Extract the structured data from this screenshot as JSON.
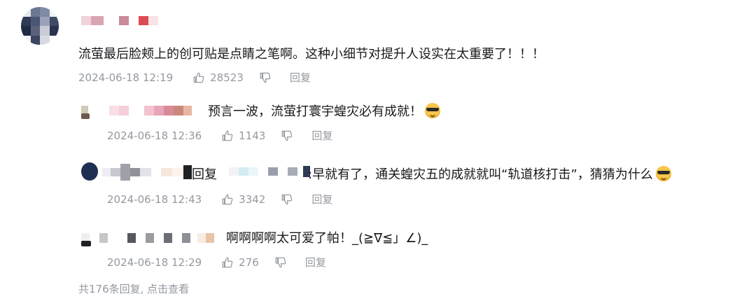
{
  "main_comment": {
    "text": "流萤最后脸颊上的创可贴是点睛之笔啊。这种小细节对提升人设实在太重要了！！！",
    "time": "2024-06-18 12:19",
    "likes": "28523",
    "reply_label": "回复"
  },
  "replies": [
    {
      "text": "预言一波，流萤打寰宇蝗灾必有成就！",
      "emoji": "sunglasses-emoji",
      "time": "2024-06-18 12:36",
      "likes": "1143",
      "reply_label": "回复"
    },
    {
      "prefix": "回复",
      "text": ":早就有了，通关蝗灾五的成就就叫“轨道核打击”，猜猜为什么",
      "emoji": "sunglasses-emoji",
      "time": "2024-06-18 12:43",
      "likes": "3342",
      "reply_label": "回复"
    },
    {
      "text": "啊啊啊啊太可爱了帕！_(≧∇≦」∠)_",
      "time": "2024-06-18 12:29",
      "likes": "276",
      "reply_label": "回复"
    }
  ],
  "more_replies": "共176条回复, 点击查看",
  "colors": {
    "meta": "#9499a0",
    "text": "#18191c"
  }
}
